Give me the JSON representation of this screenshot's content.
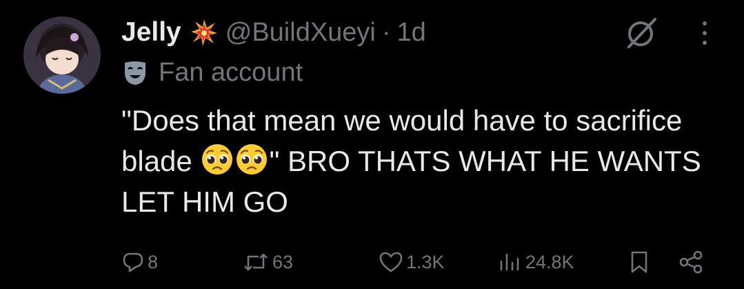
{
  "tweet": {
    "display_name": "Jelly",
    "name_emoji": "collision-emoji",
    "handle": "@BuildXueyi",
    "separator": "·",
    "time": "1d",
    "label_icon": "theater-mask-icon",
    "label": "Fan account",
    "text_part1": "\"Does that mean we would have to sacrifice blade ",
    "emojis": [
      "pleading-face-emoji",
      "pleading-face-emoji"
    ],
    "text_part2": "\" BRO THATS WHAT HE WANTS LET HIM GO"
  },
  "actions": {
    "replies": "8",
    "reposts": "63",
    "likes": "1.3K",
    "views": "24.8K"
  },
  "colors": {
    "background": "#000000",
    "text": "#e7e9ea",
    "secondary": "#71767b"
  }
}
